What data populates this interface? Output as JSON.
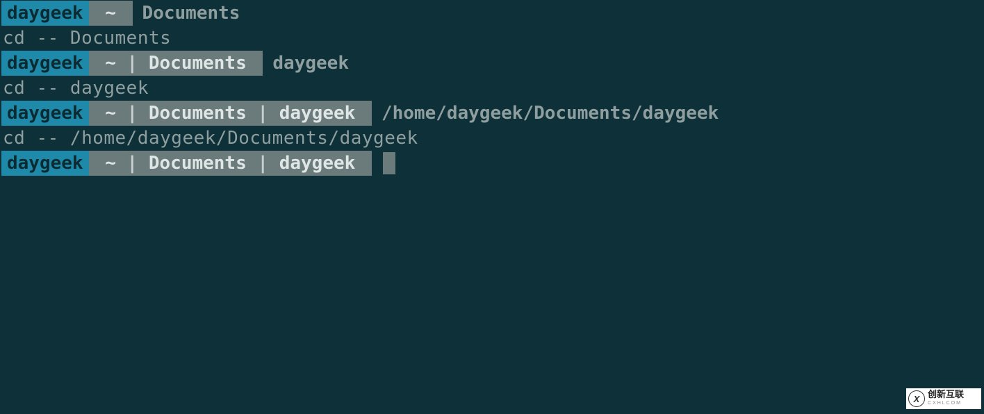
{
  "colors": {
    "background": "#0e3038",
    "user_segment_bg": "#1e89a8",
    "user_segment_fg": "#0c2a31",
    "path_segment_bg": "#6b7a7a",
    "path_segment_fg": "#dfe6e6",
    "plain_text": "#8f9f9f"
  },
  "lines": [
    {
      "type": "prompt",
      "user": "daygeek",
      "segments": [
        "~"
      ],
      "input": "Documents"
    },
    {
      "type": "output",
      "text": "cd -- Documents"
    },
    {
      "type": "prompt",
      "user": "daygeek",
      "segments": [
        "~",
        "Documents"
      ],
      "input": "daygeek"
    },
    {
      "type": "output",
      "text": "cd -- daygeek"
    },
    {
      "type": "prompt",
      "user": "daygeek",
      "segments": [
        "~",
        "Documents",
        "daygeek"
      ],
      "input": "/home/daygeek/Documents/daygeek"
    },
    {
      "type": "output",
      "text": "cd -- /home/daygeek/Documents/daygeek"
    },
    {
      "type": "prompt",
      "user": "daygeek",
      "segments": [
        "~",
        "Documents",
        "daygeek"
      ],
      "cursor": true
    }
  ],
  "watermark": {
    "icon": "X",
    "text_main": "创新互联",
    "text_sub": "CXHLCOM"
  }
}
